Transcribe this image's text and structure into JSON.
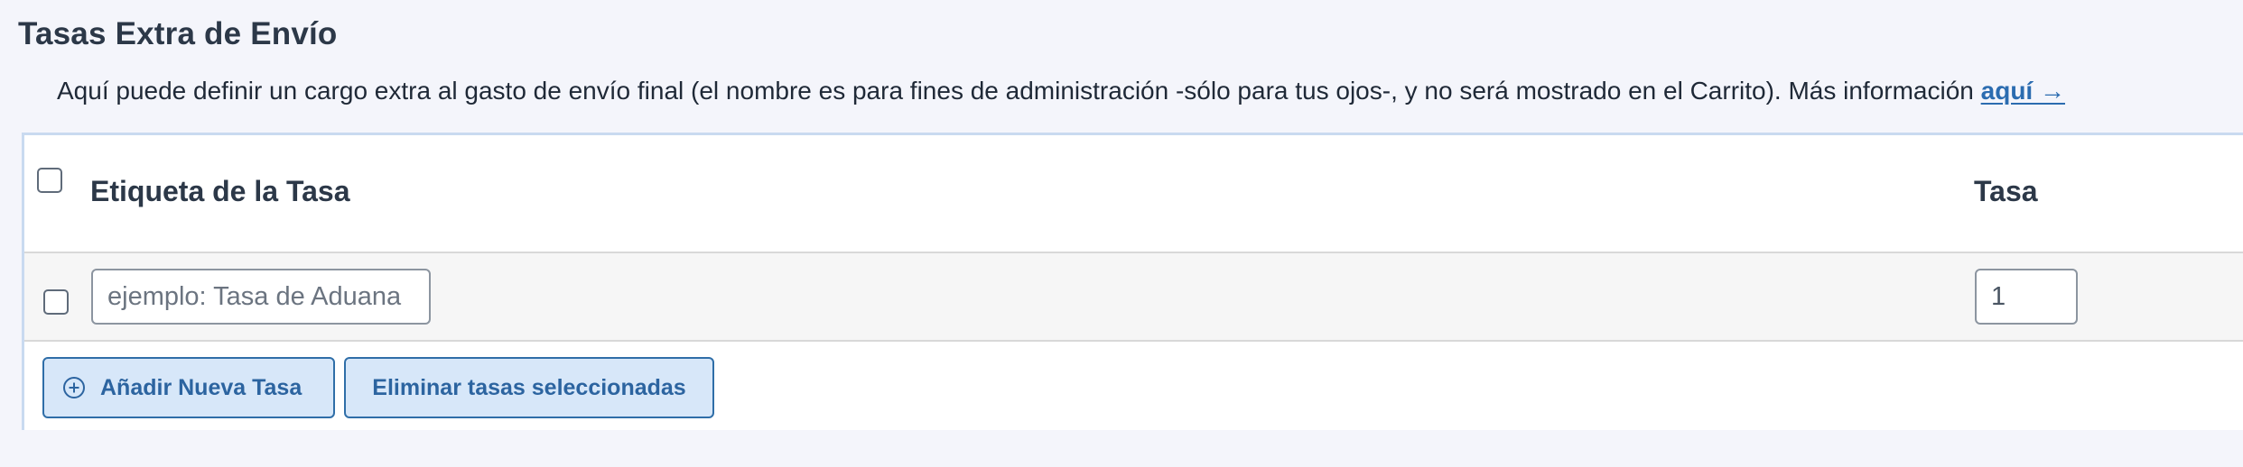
{
  "section": {
    "title": "Tasas Extra de Envío",
    "description": "Aquí puede definir un cargo extra al gasto de envío final (el nombre es para fines de administración -sólo para tus ojos-, y no será mostrado en el Carrito). Más información ",
    "link_text": "aquí →"
  },
  "table": {
    "headers": {
      "label": "Etiqueta de la Tasa",
      "rate": "Tasa"
    },
    "rows": [
      {
        "label_placeholder": "ejemplo: Tasa de Aduana",
        "label_value": "",
        "rate_value": "1"
      }
    ]
  },
  "actions": {
    "add_label": "Añadir Nueva Tasa",
    "delete_label": "Eliminar tasas seleccionadas"
  },
  "icons": {
    "add": "plus-circle-icon"
  },
  "colors": {
    "accent": "#2b6cb0",
    "button_bg": "#d7e7f9",
    "button_border": "#2f6ea8",
    "table_border": "#c9daf0",
    "row_bg": "#f6f6f6"
  }
}
